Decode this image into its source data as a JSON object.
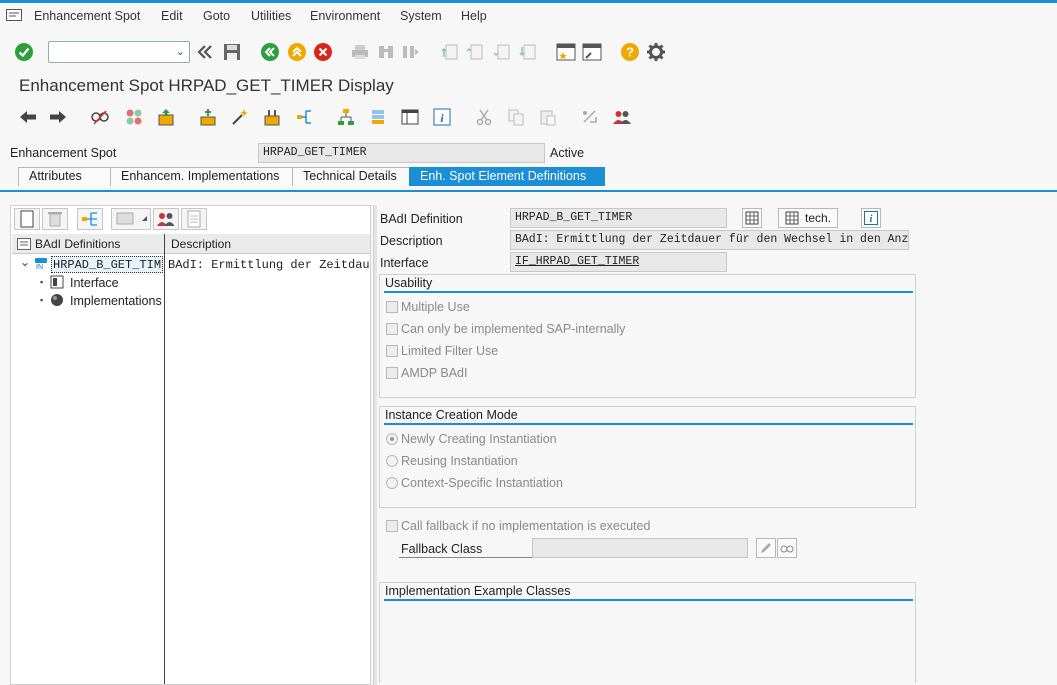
{
  "menubar": {
    "items": [
      "Enhancement Spot",
      "Edit",
      "Goto",
      "Utilities",
      "Environment",
      "System",
      "Help"
    ]
  },
  "command_field": {
    "value": ""
  },
  "window": {
    "title": "Enhancement Spot HRPAD_GET_TIMER Display"
  },
  "header": {
    "spot_label": "Enhancement Spot",
    "spot_value": "HRPAD_GET_TIMER",
    "status": "Active"
  },
  "tabs": [
    "Attributes",
    "Enhancem. Implementations",
    "Technical Details",
    "Enh. Spot Element Definitions"
  ],
  "tree": {
    "col_badi": "BAdI Definitions",
    "col_desc": "Description",
    "root_name": "HRPAD_B_GET_TIM",
    "root_desc": "BAdI: Ermittlung der Zeitdauer für de",
    "child_interface": "Interface",
    "child_implementations": "Implementations",
    "badge": "IN"
  },
  "detail": {
    "badi_def_label": "BAdI Definition",
    "badi_def_value": "HRPAD_B_GET_TIMER",
    "tech_button": "tech.",
    "description_label": "Description",
    "description_value": "BAdI: Ermittlung der Zeitdauer für den Wechsel in den Anzeigemodus",
    "interface_label": "Interface",
    "interface_value": "IF_HRPAD_GET_TIMER"
  },
  "usability": {
    "title": "Usability",
    "options": [
      "Multiple Use",
      "Can only be implemented SAP-internally",
      "Limited Filter Use",
      "AMDP BAdI"
    ]
  },
  "instance": {
    "title": "Instance Creation Mode",
    "options": [
      "Newly Creating Instantiation",
      "Reusing Instantiation",
      "Context-Specific Instantiation"
    ],
    "selected": "Newly Creating Instantiation"
  },
  "fallback": {
    "checkbox": "Call fallback if no implementation is executed",
    "class_label": "Fallback Class",
    "class_value": ""
  },
  "examples": {
    "title": "Implementation Example Classes"
  },
  "colors": {
    "accent": "#1a8fd6",
    "ok_green": "#2e9e3e",
    "cancel_red": "#d9261c",
    "help_yellow": "#f0a800"
  }
}
